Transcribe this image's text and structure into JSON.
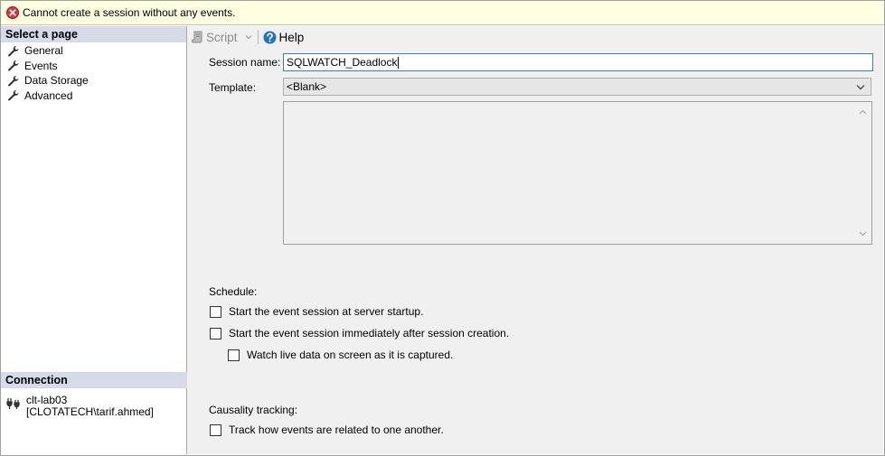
{
  "error": {
    "message": "Cannot create a session without any events."
  },
  "left_pane": {
    "select_page_header": "Select a page",
    "pages": [
      {
        "label": "General"
      },
      {
        "label": "Events"
      },
      {
        "label": "Data Storage"
      },
      {
        "label": "Advanced"
      }
    ],
    "connection_header": "Connection",
    "connection": {
      "server": "clt-lab03",
      "user": "[CLOTATECH\\tarif.ahmed]"
    }
  },
  "toolbar": {
    "script_label": "Script",
    "help_label": "Help"
  },
  "form": {
    "session_name_label": "Session name:",
    "session_name_value": "SQLWATCH_Deadlock",
    "template_label": "Template:",
    "template_value": "<Blank>",
    "schedule_label": "Schedule:",
    "start_at_startup": "Start the event session at server startup.",
    "start_immediately": "Start the event session immediately after session creation.",
    "watch_live": "Watch live data on screen as it is captured.",
    "causality_label": "Causality tracking:",
    "track_related": "Track how events are related to one another."
  },
  "colors": {
    "error_bg": "#ffffe1",
    "header_bg": "#d6dbe9",
    "error_icon": "#d9363e",
    "help_icon": "#1e73be"
  }
}
